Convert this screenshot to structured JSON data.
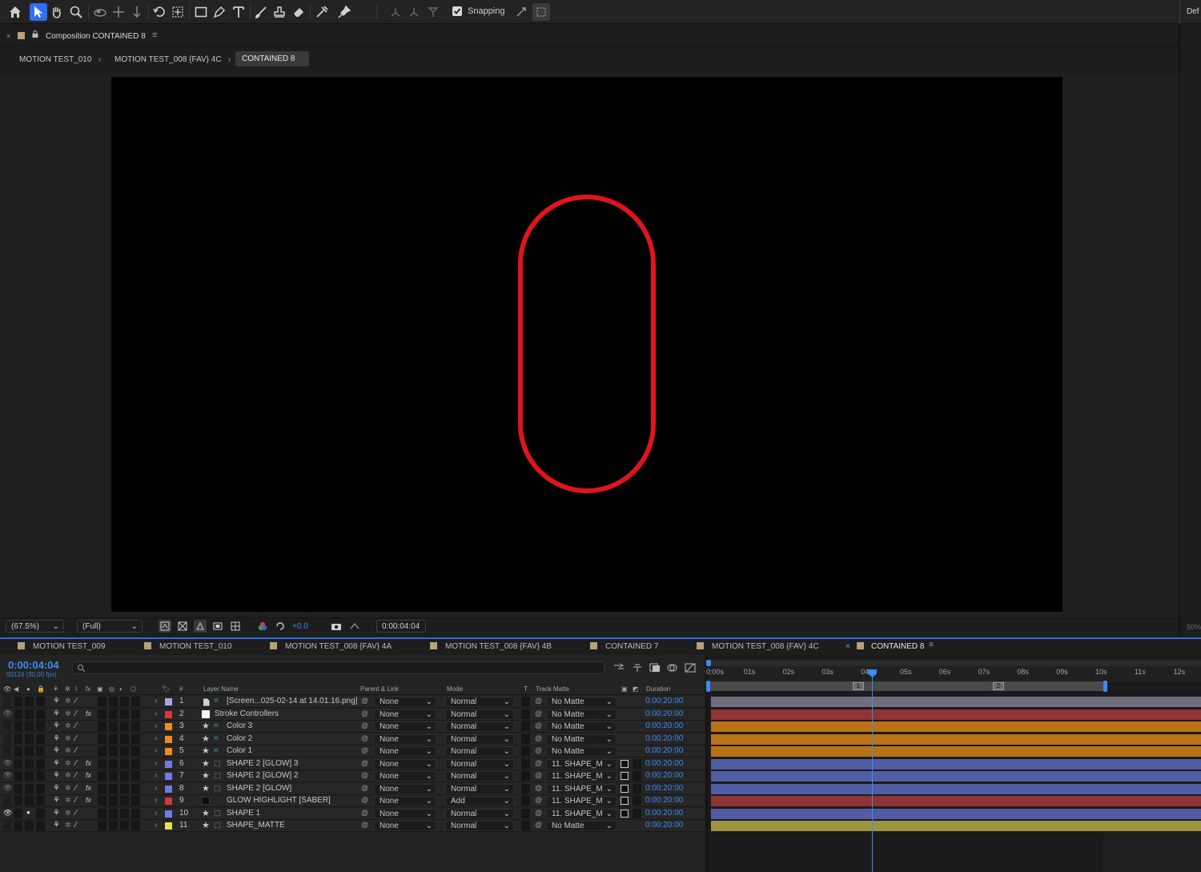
{
  "toolbar": {
    "snapping_label": "Snapping",
    "right_label": "Def",
    "tools": [
      "home-icon",
      "selection-tool-icon",
      "hand-tool-icon",
      "zoom-tool-icon",
      "orbit-camera-icon",
      "pan-camera-icon",
      "dolly-camera-icon",
      "rotation-tool-icon",
      "pan-behind-icon",
      "rectangle-tool-icon",
      "pen-tool-icon",
      "type-tool-icon",
      "brush-tool-icon",
      "clone-stamp-icon",
      "eraser-icon",
      "roto-brush-icon",
      "puppet-pin-icon"
    ]
  },
  "comp_panel": {
    "title": "Composition CONTAINED 8",
    "breadcrumbs": [
      "MOTION TEST_010",
      "MOTION TEST_008 {FAV} 4C",
      "CONTAINED 8"
    ]
  },
  "viewer_footer": {
    "zoom": "(67.5%)",
    "resolution": "(Full)",
    "exposure": "+0.0",
    "timecode": "0:00:04:04",
    "right_zoom": "50%"
  },
  "tabs": [
    {
      "label": "MOTION TEST_009"
    },
    {
      "label": "MOTION TEST_010"
    },
    {
      "label": "MOTION TEST_008 {FAV} 4A"
    },
    {
      "label": "MOTION TEST_008 {FAV} 4B"
    },
    {
      "label": "CONTAINED 7"
    },
    {
      "label": "MOTION TEST_008 {FAV} 4C"
    },
    {
      "label": "CONTAINED 8"
    }
  ],
  "timeline": {
    "timecode": "0:00:04:04",
    "frames": "00124 (30.00 fps)",
    "columns": {
      "num": "#",
      "layer_name": "Layer Name",
      "parent": "Parent & Link",
      "mode": "Mode",
      "t": "T",
      "track_matte": "Track Matte",
      "duration": "Duration"
    },
    "ruler": [
      "0:00s",
      "01s",
      "02s",
      "03s",
      "04s",
      "05s",
      "06s",
      "07s",
      "08s",
      "09s",
      "10s",
      "11s",
      "12s"
    ],
    "markers": [
      "1",
      "2"
    ],
    "layers": [
      {
        "num": "1",
        "name": "[Screen...025-02-14 at 14.01.16.png]",
        "label_color": "#a9a9e0",
        "parent": "None",
        "mode": "Normal",
        "matte": "No Matte",
        "duration": "0:00:20:00",
        "bar_color": "#6e6e7e"
      },
      {
        "num": "2",
        "name": "Stroke Controllers",
        "label_color": "#d23a3a",
        "parent": "None",
        "mode": "Normal",
        "matte": "No Matte",
        "duration": "0:00:20:00",
        "bar_color": "#8e3434"
      },
      {
        "num": "3",
        "name": "Color 3",
        "label_color": "#f08c1c",
        "parent": "None",
        "mode": "Normal",
        "matte": "No Matte",
        "duration": "0:00:20:00",
        "bar_color": "#b87317"
      },
      {
        "num": "4",
        "name": "Color 2",
        "label_color": "#f08c1c",
        "parent": "None",
        "mode": "Normal",
        "matte": "No Matte",
        "duration": "0:00:20:00",
        "bar_color": "#b87317"
      },
      {
        "num": "5",
        "name": "Color 1",
        "label_color": "#f08c1c",
        "parent": "None",
        "mode": "Normal",
        "matte": "No Matte",
        "duration": "0:00:20:00",
        "bar_color": "#b87317"
      },
      {
        "num": "6",
        "name": "SHAPE 2 [GLOW] 3",
        "label_color": "#6f7ce4",
        "parent": "None",
        "mode": "Normal",
        "matte": "11. SHAPE_M",
        "duration": "0:00:20:00",
        "bar_color": "#525ca4"
      },
      {
        "num": "7",
        "name": "SHAPE 2 [GLOW] 2",
        "label_color": "#6f7ce4",
        "parent": "None",
        "mode": "Normal",
        "matte": "11. SHAPE_M",
        "duration": "0:00:20:00",
        "bar_color": "#525ca4"
      },
      {
        "num": "8",
        "name": "SHAPE 2 [GLOW]",
        "label_color": "#6f7ce4",
        "parent": "None",
        "mode": "Normal",
        "matte": "11. SHAPE_M",
        "duration": "0:00:20:00",
        "bar_color": "#525ca4"
      },
      {
        "num": "9",
        "name": "GLOW HIGHLIGHT [SABER]",
        "label_color": "#d23a3a",
        "parent": "None",
        "mode": "Add",
        "matte": "11. SHAPE_M",
        "duration": "0:00:20:00",
        "bar_color": "#8e3434"
      },
      {
        "num": "10",
        "name": "SHAPE 1",
        "label_color": "#6f7ce4",
        "parent": "None",
        "mode": "Normal",
        "matte": "11. SHAPE_M",
        "duration": "0:00:20:00",
        "bar_color": "#525ca4"
      },
      {
        "num": "11",
        "name": "SHAPE_MATTE",
        "label_color": "#e6df52",
        "parent": "None",
        "mode": "Normal",
        "matte": "No Matte",
        "duration": "0:00:20:00",
        "bar_color": "#9c9641"
      }
    ]
  },
  "canvas": {
    "shape_stroke_color": "#e0141c"
  }
}
